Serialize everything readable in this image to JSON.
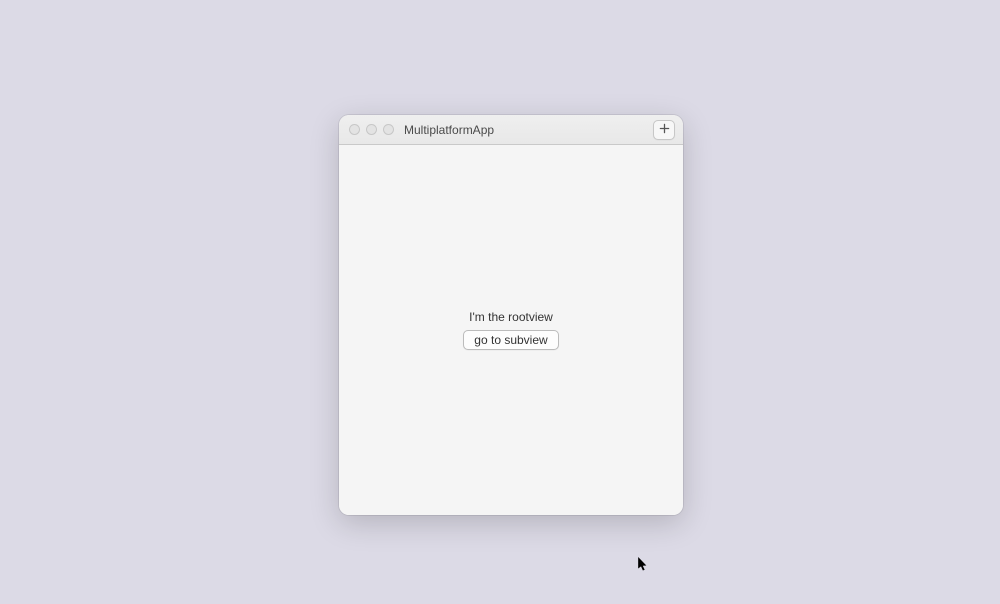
{
  "window": {
    "title": "MultiplatformApp"
  },
  "content": {
    "rootview_label": "I'm the rootview",
    "subview_button_label": "go to subview"
  }
}
